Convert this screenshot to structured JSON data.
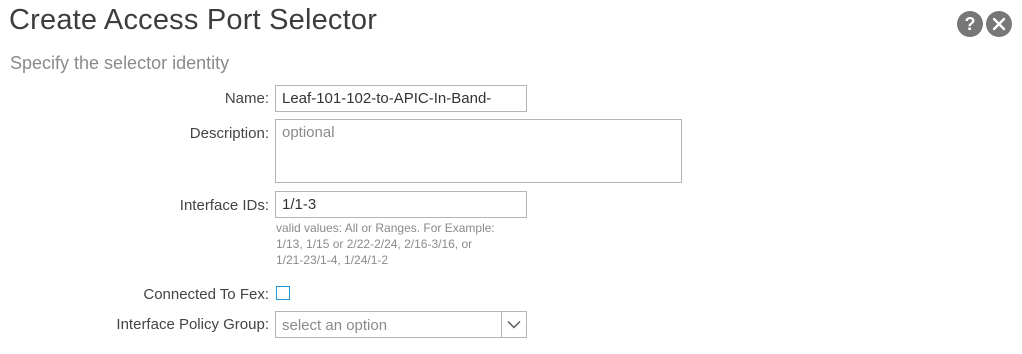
{
  "dialog": {
    "title": "Create Access Port Selector",
    "subtitle": "Specify the selector identity",
    "help_icon": "question-mark-icon",
    "close_icon": "close-icon",
    "help_glyph": "?"
  },
  "form": {
    "name": {
      "label": "Name:",
      "value": "Leaf-101-102-to-APIC-In-Band-"
    },
    "description": {
      "label": "Description:",
      "placeholder": "optional"
    },
    "interface_ids": {
      "label": "Interface IDs:",
      "value": "1/1-3",
      "hint_lines": [
        "valid values: All or Ranges. For Example:",
        "1/13, 1/15 or 2/22-2/24, 2/16-3/16, or",
        "1/21-23/1-4, 1/24/1-2"
      ]
    },
    "connected_to_fex": {
      "label": "Connected To Fex:",
      "checked": false
    },
    "interface_policy_group": {
      "label": "Interface Policy Group:",
      "placeholder": "select an option"
    }
  },
  "colors": {
    "accent": "#1a9ad6",
    "icon_bg": "#777777"
  }
}
